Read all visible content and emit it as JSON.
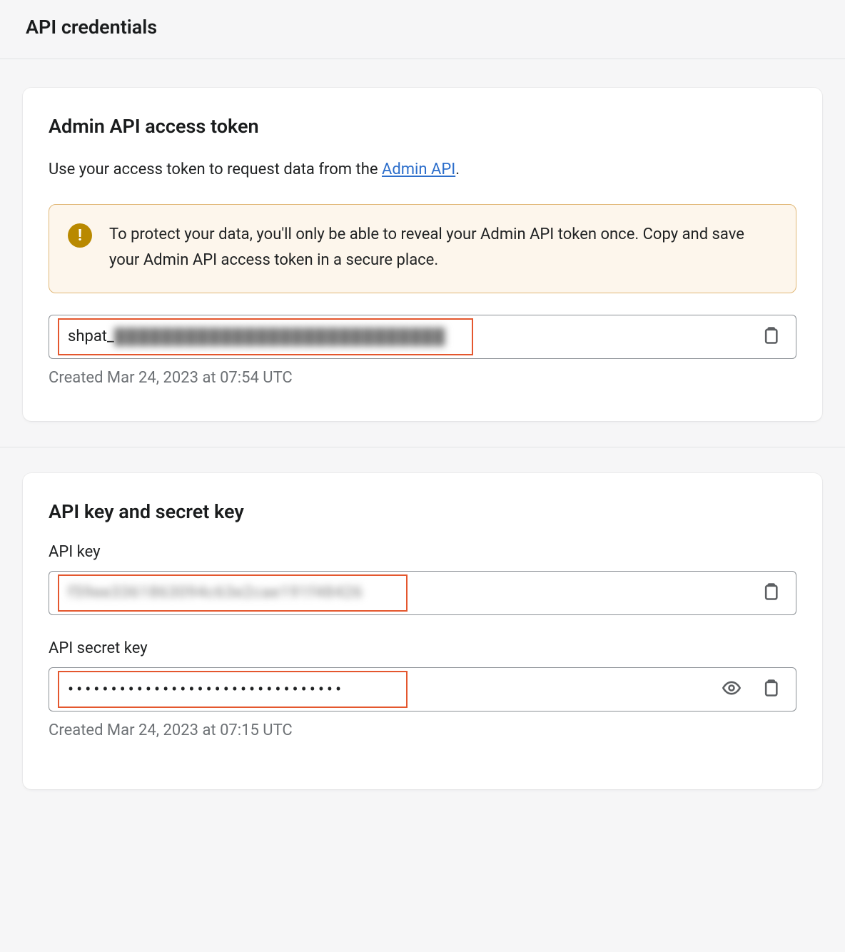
{
  "header": {
    "title": "API credentials"
  },
  "token_card": {
    "title": "Admin API access token",
    "desc_prefix": "Use your access token to request data from the ",
    "desc_link": "Admin API",
    "desc_suffix": ".",
    "alert_text": "To protect your data, you'll only be able to reveal your Admin API token once. Copy and save your Admin API access token in a secure place.",
    "token_prefix": "shpat_",
    "token_blur": "████████████████████████████",
    "created": "Created Mar 24, 2023 at 07:54 UTC"
  },
  "keys_card": {
    "title": "API key and secret key",
    "api_key_label": "API key",
    "api_key_blur": "f59ee3361863094c63e2cae191f48426",
    "secret_label": "API secret key",
    "secret_dots": "••••••••••••••••••••••••••••••••",
    "created": "Created Mar 24, 2023 at 07:15 UTC"
  }
}
